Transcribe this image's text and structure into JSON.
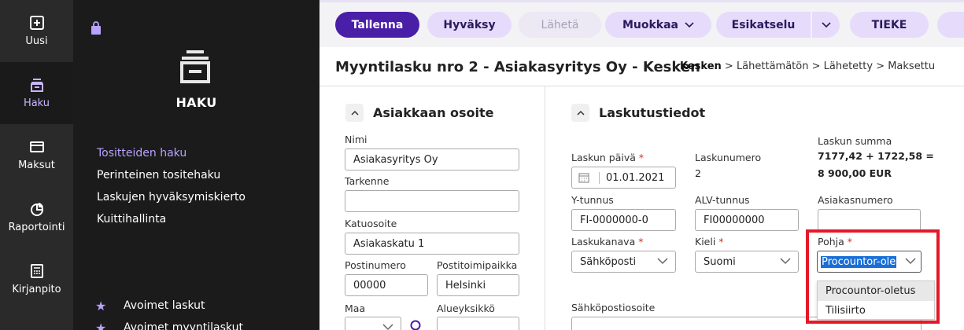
{
  "rail": [
    {
      "label": "Uusi",
      "icon": "plus-square-icon"
    },
    {
      "label": "Haku",
      "icon": "inbox-stack-icon"
    },
    {
      "label": "Maksut",
      "icon": "card-icon"
    },
    {
      "label": "Raportointi",
      "icon": "pie-chart-icon"
    },
    {
      "label": "Kirjanpito",
      "icon": "calculator-icon"
    }
  ],
  "panel": {
    "title": "HAKU",
    "links": [
      "Tositteiden haku",
      "Perinteinen tositehaku",
      "Laskujen hyväksymiskierto",
      "Kuittihallinta"
    ],
    "favorites": [
      "Avoimet laskut",
      "Avoimet myyntilaskut"
    ]
  },
  "toolbar": {
    "save": "Tallenna",
    "approve": "Hyväksy",
    "send": "Lähetä",
    "edit": "Muokkaa",
    "preview": "Esikatselu",
    "tieke": "TIEKE"
  },
  "header": {
    "title": "Myyntilasku nro 2 - Asiakasyritys Oy - Kesken",
    "crumb_current": "Kesken",
    "crumbs_rest": " > Lähettämätön > Lähetetty > Maksettu",
    "crumb_sep": ">"
  },
  "address": {
    "section_title": "Asiakkaan osoite",
    "name_label": "Nimi",
    "name_value": "Asiakasyritys Oy",
    "extra_label": "Tarkenne",
    "extra_value": "",
    "street_label": "Katuosoite",
    "street_value": "Asiakaskatu 1",
    "zip_label": "Postinumero",
    "zip_value": "00000",
    "city_label": "Postitoimipaikka",
    "city_value": "Helsinki",
    "country_label": "Maa",
    "country_value": "",
    "district_label": "Alueyksikkö"
  },
  "billing": {
    "section_title": "Laskutustiedot",
    "date_label": "Laskun päivä",
    "date_value": "01.01.2021",
    "number_label": "Laskunumero",
    "number_value": "2",
    "sum_label": "Laskun summa",
    "sum_line1": "7177,42 + 1722,58 =",
    "sum_line2": "8 900,00 EUR",
    "ytunnus_label": "Y-tunnus",
    "ytunnus_value": "FI-0000000-0",
    "alv_label": "ALV-tunnus",
    "alv_value": "FI00000000",
    "customer_no_label": "Asiakasnumero",
    "customer_no_value": "",
    "channel_label": "Laskukanava",
    "channel_value": "Sähköposti",
    "lang_label": "Kieli",
    "lang_value": "Suomi",
    "template_label": "Pohja",
    "template_value": "Procountor-ole",
    "template_options": [
      "Procountor-oletus",
      "Tilisiirto"
    ],
    "email_label": "Sähköpostiosoite",
    "required_mark": "*"
  },
  "colors": {
    "accent": "#4a1fa8",
    "highlight": "#e3192a"
  }
}
